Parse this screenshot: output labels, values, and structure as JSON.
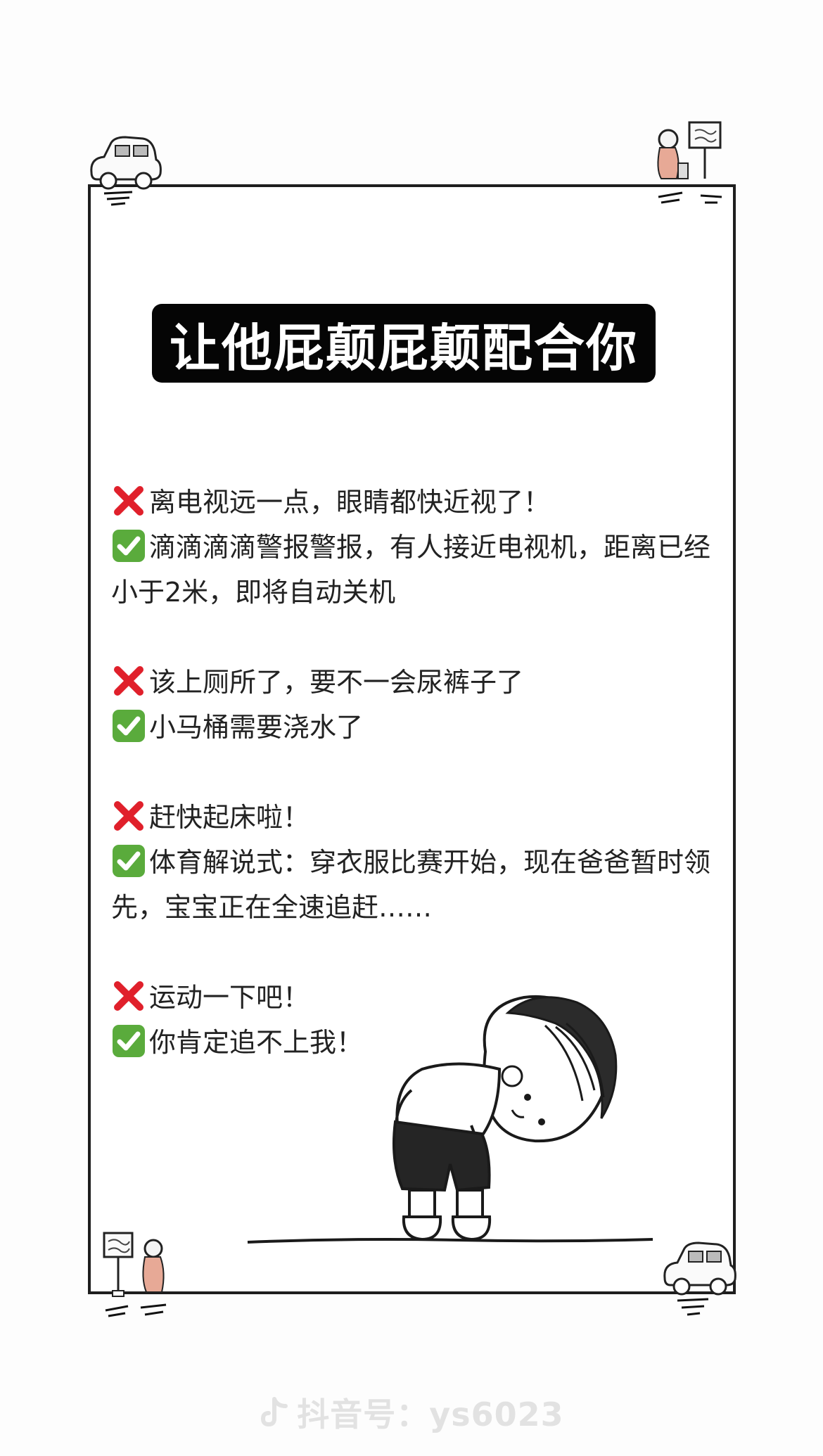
{
  "title": "让他屁颠屁颠配合你",
  "icons": {
    "wrong": "cross-mark-icon",
    "right": "check-mark-icon"
  },
  "colors": {
    "cross": "#e0202b",
    "check": "#5aab3c",
    "title_bg": "#050505",
    "title_text": "#ffffff"
  },
  "groups": [
    {
      "wrong": "离电视远一点，眼睛都快近视了！",
      "right": "滴滴滴滴警报警报，有人接近电视机，距离已经小于2米，即将自动关机"
    },
    {
      "wrong": "该上厕所了，要不一会尿裤子了",
      "right": "小马桶需要浇水了"
    },
    {
      "wrong": "赶快起床啦！",
      "right": "体育解说式：穿衣服比赛开始，现在爸爸暂时领先，宝宝正在全速追赶……"
    },
    {
      "wrong": "运动一下吧！",
      "right": "你肯定追不上我！"
    }
  ],
  "watermark": "抖音号：ys6023"
}
